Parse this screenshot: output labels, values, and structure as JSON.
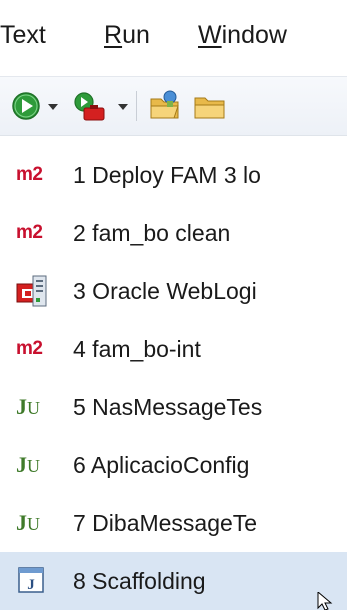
{
  "menubar": {
    "items": [
      {
        "label": "Text"
      },
      {
        "mnemonic": "R",
        "rest": "un"
      },
      {
        "mnemonic": "W",
        "rest": "indow"
      }
    ]
  },
  "toolbar": {
    "buttons": [
      {
        "icon": "run-icon",
        "dropdown": true
      },
      {
        "icon": "external-tools-icon",
        "dropdown": true
      },
      {
        "icon": "open-folder-icon",
        "dropdown": false
      },
      {
        "icon": "folder-icon",
        "dropdown": false
      }
    ]
  },
  "launch_history": {
    "items": [
      {
        "icon": "maven-m2-icon",
        "label": "1 Deploy FAM 3 lo"
      },
      {
        "icon": "maven-m2-icon",
        "label": "2 fam_bo clean"
      },
      {
        "icon": "weblogic-server-icon",
        "label": "3 Oracle WebLogi"
      },
      {
        "icon": "maven-m2-icon",
        "label": "4 fam_bo-int"
      },
      {
        "icon": "junit-icon",
        "label": "5 NasMessageTes"
      },
      {
        "icon": "junit-icon",
        "label": "6 AplicacioConfig"
      },
      {
        "icon": "junit-icon",
        "label": "7 DibaMessageTe"
      },
      {
        "icon": "java-application-icon",
        "label": "8 Scaffolding",
        "selected": true
      }
    ]
  },
  "icon_glyphs": {
    "maven": "m2",
    "junit_j": "J",
    "junit_u": "U"
  },
  "colors": {
    "maven": "#c8102e",
    "junit": "#3f7a2a",
    "selection": "#d9e5f3",
    "run": "#2e9b3a"
  }
}
